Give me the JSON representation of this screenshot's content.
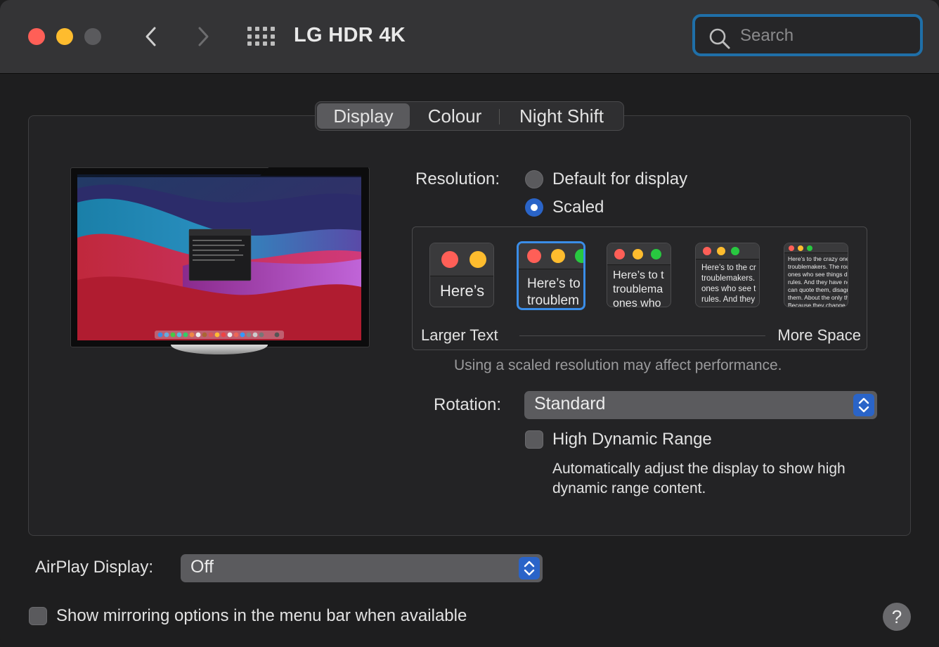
{
  "window": {
    "title": "LG HDR 4K",
    "search_placeholder": "Search"
  },
  "tabs": [
    {
      "label": "Display",
      "active": true
    },
    {
      "label": "Colour",
      "active": false
    },
    {
      "label": "Night Shift",
      "active": false
    }
  ],
  "resolution": {
    "label": "Resolution:",
    "options": [
      {
        "label": "Default for display",
        "selected": false
      },
      {
        "label": "Scaled",
        "selected": true
      }
    ],
    "scale_left_label": "Larger Text",
    "scale_right_label": "More Space",
    "thumbs": [
      {
        "text": "Here’s",
        "selected": false
      },
      {
        "text": "Here’s to\ntroublem",
        "selected": true
      },
      {
        "text": "Here’s to t\ntroublema\nones who",
        "selected": false
      },
      {
        "text": "Here’s to the cr\ntroublemakers.\nones who see t\nrules. And they",
        "selected": false
      },
      {
        "text": "Here’s to the crazy one\ntroublemakers. The rou\nones who see things dif\nrules. And they have no\ncan quote them, disagre\nthem. About the only th\nBecause they change th",
        "selected": false
      }
    ],
    "note": "Using a scaled resolution may affect performance."
  },
  "rotation": {
    "label": "Rotation:",
    "value": "Standard"
  },
  "hdr": {
    "label": "High Dynamic Range",
    "checked": false,
    "description": "Automatically adjust the display to show high dynamic range content."
  },
  "airplay": {
    "label": "AirPlay Display:",
    "value": "Off"
  },
  "mirroring": {
    "label": "Show mirroring options in the menu bar when available",
    "checked": false
  },
  "help_label": "?",
  "colors": {
    "accent": "#2a64c8",
    "close": "#ff5f57",
    "minimize": "#febc2e",
    "zoom": "#5a5a5d",
    "search_border": "#1f6fa8"
  }
}
